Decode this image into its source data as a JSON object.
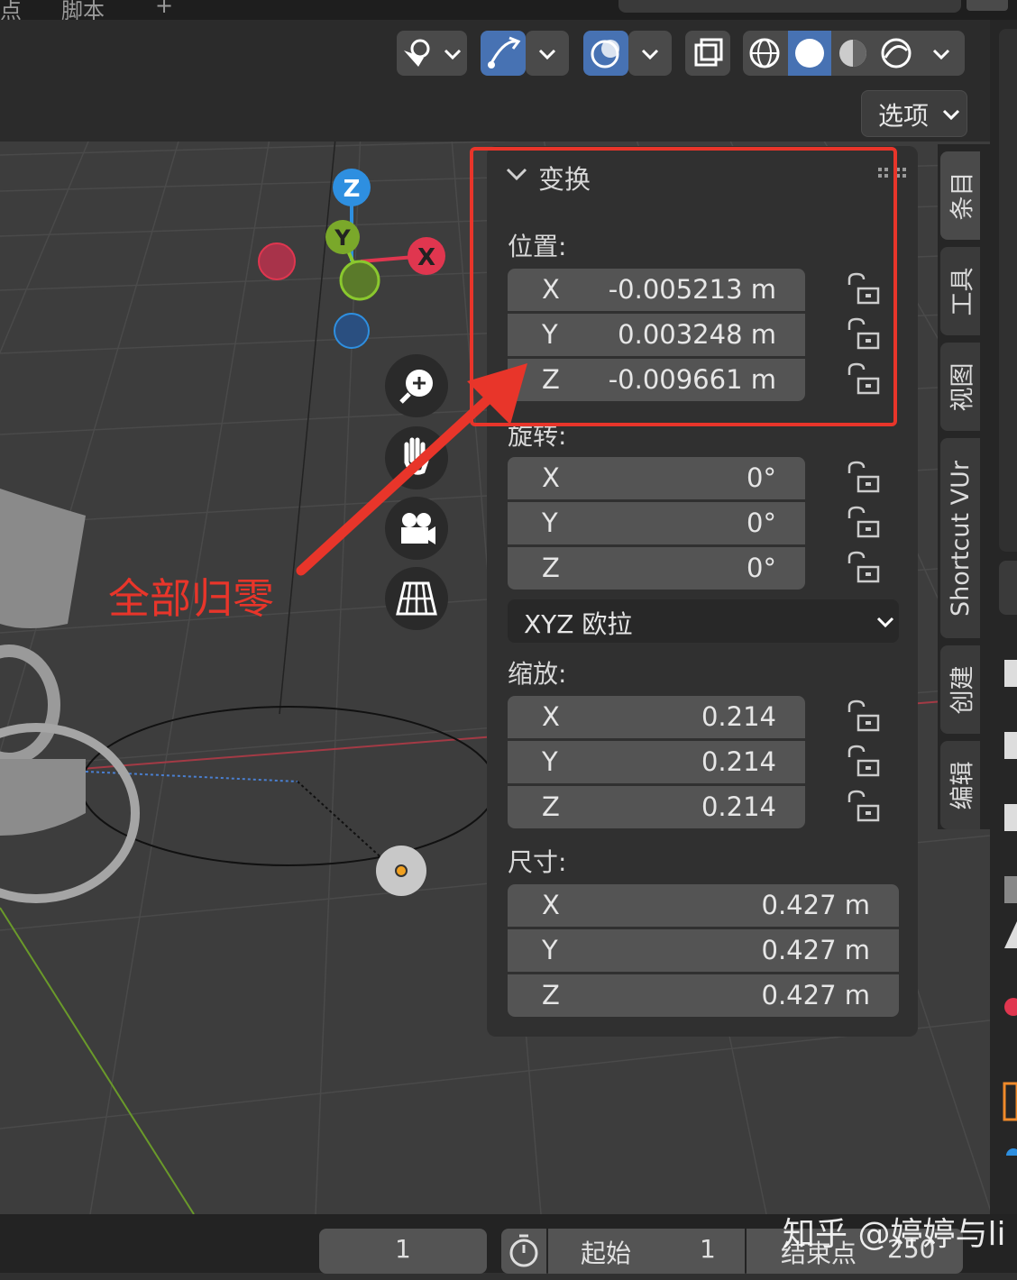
{
  "top_tabs": [
    "点",
    "脚本",
    "+"
  ],
  "header": {
    "options_label": "选项"
  },
  "transform_panel": {
    "title": "变换",
    "location_label": "位置:",
    "location": [
      {
        "axis": "X",
        "value": "-0.005213 m"
      },
      {
        "axis": "Y",
        "value": "0.003248 m"
      },
      {
        "axis": "Z",
        "value": "-0.009661 m"
      }
    ],
    "rotation_label": "旋转:",
    "rotation": [
      {
        "axis": "X",
        "value": "0°"
      },
      {
        "axis": "Y",
        "value": "0°"
      },
      {
        "axis": "Z",
        "value": "0°"
      }
    ],
    "rotation_mode": "XYZ 欧拉",
    "scale_label": "缩放:",
    "scale": [
      {
        "axis": "X",
        "value": "0.214"
      },
      {
        "axis": "Y",
        "value": "0.214"
      },
      {
        "axis": "Z",
        "value": "0.214"
      }
    ],
    "dimensions_label": "尺寸:",
    "dimensions": [
      {
        "axis": "X",
        "value": "0.427 m"
      },
      {
        "axis": "Y",
        "value": "0.427 m"
      },
      {
        "axis": "Z",
        "value": "0.427 m"
      }
    ]
  },
  "side_tabs": [
    "条目",
    "工具",
    "视图",
    "Shortcut VUr",
    "创建",
    "编辑"
  ],
  "gizmo": {
    "z": "Z",
    "y": "Y",
    "x": "X"
  },
  "annotation": {
    "text": "全部归零",
    "color": "#e8352a"
  },
  "timeline": {
    "current_frame": "1",
    "start_label": "起始",
    "start_value": "1",
    "end_label": "结束点",
    "end_value": "250"
  },
  "watermark": "知乎 @婷婷与li",
  "colors": {
    "accent_blue": "#4772b3",
    "annotation_red": "#e8352a",
    "axis_x": "#e0364f",
    "axis_y": "#8ac82e",
    "axis_z": "#2e8fe0"
  }
}
